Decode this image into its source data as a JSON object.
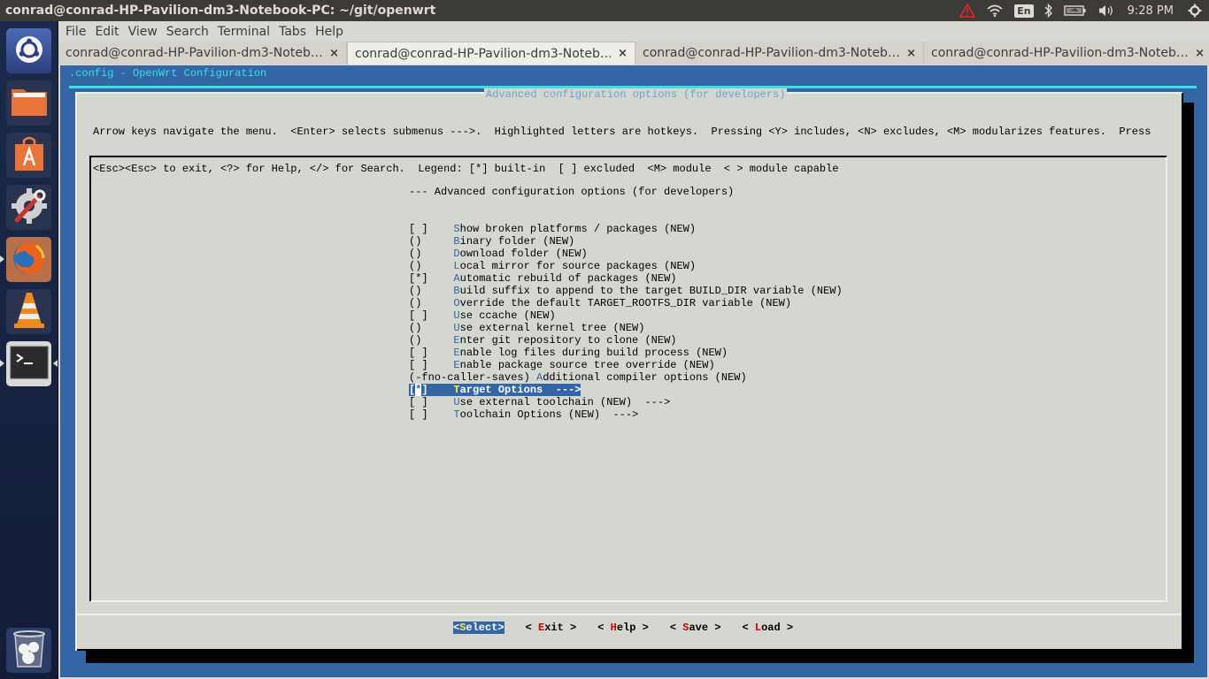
{
  "top_panel": {
    "window_title": "conrad@conrad-HP-Pavilion-dm3-Notebook-PC: ~/git/openwrt",
    "indicators": {
      "alert_icon": "warning-triangle-icon",
      "network_icon": "wifi-icon",
      "keyboard_layout": "En",
      "bluetooth_icon": "bluetooth-icon",
      "battery_icon": "battery-charging-icon",
      "volume_icon": "volume-icon",
      "clock": "9:28 PM",
      "session_icon": "power-gear-icon"
    }
  },
  "launcher": {
    "items": [
      {
        "name": "Dash",
        "icon": "ubuntu-logo-icon"
      },
      {
        "name": "Files",
        "icon": "folder-icon"
      },
      {
        "name": "Ubuntu Software Center",
        "icon": "software-center-icon"
      },
      {
        "name": "System Settings",
        "icon": "settings-wrench-icon"
      },
      {
        "name": "Firefox",
        "icon": "firefox-icon",
        "running": true
      },
      {
        "name": "VLC",
        "icon": "vlc-cone-icon"
      },
      {
        "name": "Terminal",
        "icon": "terminal-icon",
        "running": true,
        "focused": true
      },
      {
        "name": "Trash",
        "icon": "trash-icon"
      }
    ]
  },
  "terminal": {
    "menu": [
      "File",
      "Edit",
      "View",
      "Search",
      "Terminal",
      "Tabs",
      "Help"
    ],
    "tabs": [
      {
        "label": "conrad@conrad-HP-Pavilion-dm3-Noteb…",
        "close": "×",
        "active": false
      },
      {
        "label": "conrad@conrad-HP-Pavilion-dm3-Noteb…",
        "close": "×",
        "active": true
      },
      {
        "label": "conrad@conrad-HP-Pavilion-dm3-Noteb…",
        "close": "×",
        "active": false
      },
      {
        "label": "conrad@conrad-HP-Pavilion-dm3-Noteb…",
        "close": "×",
        "active": false
      }
    ]
  },
  "menuconfig": {
    "backtitle": ".config - OpenWrt Configuration",
    "dialog_title": "Advanced configuration options (for developers)",
    "help_lines": [
      "Arrow keys navigate the menu.  <Enter> selects submenus --->.  Highlighted letters are hotkeys.  Pressing <Y> includes, <N> excludes, <M> modularizes features.  Press",
      "<Esc><Esc> to exit, <?> for Help, </> for Search.  Legend: [*] built-in  [ ] excluded  <M> module  < > module capable"
    ],
    "header": "--- Advanced configuration options (for developers)",
    "items": [
      {
        "prefix": "[ ]    ",
        "hotkey": "S",
        "rest": "how broken platforms / packages (NEW)"
      },
      {
        "prefix": "()     ",
        "hotkey": "B",
        "rest": "inary folder (NEW)"
      },
      {
        "prefix": "()     ",
        "hotkey": "D",
        "rest": "ownload folder (NEW)"
      },
      {
        "prefix": "()     ",
        "hotkey": "L",
        "rest": "ocal mirror for source packages (NEW)"
      },
      {
        "prefix": "[*]    ",
        "hotkey": "A",
        "rest": "utomatic rebuild of packages (NEW)"
      },
      {
        "prefix": "()     ",
        "hotkey": "B",
        "rest": "uild suffix to append to the target BUILD_DIR variable (NEW)"
      },
      {
        "prefix": "()     ",
        "hotkey": "O",
        "rest": "verride the default TARGET_ROOTFS_DIR variable (NEW)"
      },
      {
        "prefix": "[ ]    ",
        "hotkey": "U",
        "rest": "se ccache (NEW)"
      },
      {
        "prefix": "()     ",
        "hotkey": "U",
        "rest": "se external kernel tree (NEW)"
      },
      {
        "prefix": "()     ",
        "hotkey": "E",
        "rest": "nter git repository to clone (NEW)"
      },
      {
        "prefix": "[ ]    ",
        "hotkey": "E",
        "rest": "nable log files during build process (NEW)"
      },
      {
        "prefix": "[ ]    ",
        "hotkey": "E",
        "rest": "nable package source tree override (NEW)"
      },
      {
        "prefix": "(-fno-caller-saves) ",
        "hotkey": "A",
        "rest": "dditional compiler options (NEW)"
      },
      {
        "prefix_open": "[",
        "prefix_star": "*",
        "prefix_close": "]    ",
        "hotkey": "T",
        "rest": "arget Options  --->",
        "selected": true
      },
      {
        "prefix": "[ ]    ",
        "hotkey": "U",
        "rest": "se external toolchain (NEW)  --->"
      },
      {
        "prefix": "[ ]    ",
        "hotkey": "T",
        "rest": "oolchain Options (NEW)  --->"
      }
    ],
    "buttons": [
      {
        "open": "<",
        "hotkey": "S",
        "rest": "elect",
        "close": ">",
        "selected": true
      },
      {
        "open": "< ",
        "hotkey": "E",
        "rest": "xit",
        "close": " >"
      },
      {
        "open": "< ",
        "hotkey": "H",
        "rest": "elp",
        "close": " >"
      },
      {
        "open": "< ",
        "hotkey": "S",
        "rest": "ave",
        "close": " >"
      },
      {
        "open": "< ",
        "hotkey": "L",
        "rest": "oad",
        "close": " >"
      }
    ]
  },
  "colors": {
    "terminal_bg": "#3465a5",
    "dialog_bg": "#d3d7cf",
    "highlight": "#3465a4",
    "backtitle": "#34e2e2",
    "hotkey_selected": "#fce94f",
    "button_hotkey": "#cc0000"
  }
}
